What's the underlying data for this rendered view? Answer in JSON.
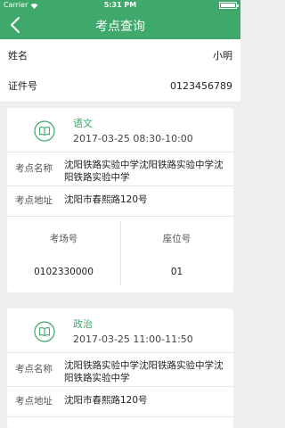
{
  "status_bar": {
    "carrier": "Carrier",
    "time": "5:31 PM"
  },
  "header": {
    "title": "考点查询"
  },
  "profile": {
    "name_label": "姓名",
    "name_value": "小明",
    "id_label": "证件号",
    "id_value": "0123456789"
  },
  "exams": [
    {
      "subject": "语文",
      "time": "2017-03-25 08:30-10:00",
      "site_label": "考点名称",
      "site_value": "沈阳铁路实验中学沈阳铁路实验中学沈阳铁路实验中学",
      "address_label": "考点地址",
      "address_value": "沈阳市春熙路120号",
      "room_label": "考场号",
      "room_value": "0102330000",
      "seat_label": "座位号",
      "seat_value": "01"
    },
    {
      "subject": "政治",
      "time": "2017-03-25 11:00-11:50",
      "site_label": "考点名称",
      "site_value": "沈阳铁路实验中学沈阳铁路实验中学沈阳铁路实验中学",
      "address_label": "考点地址",
      "address_value": "沈阳市春熙路120号"
    }
  ],
  "colors": {
    "brand": "#3fa86b",
    "background": "#efefef"
  }
}
